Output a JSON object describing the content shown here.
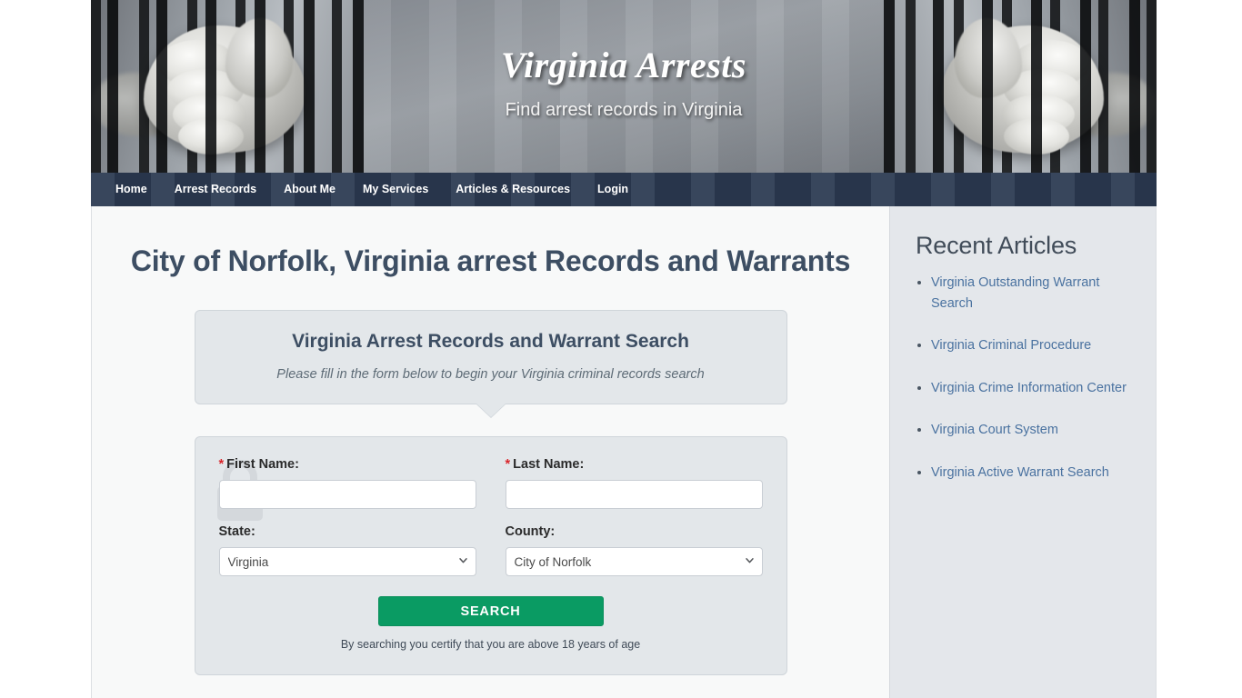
{
  "header": {
    "site_title": "Virginia Arrests",
    "tagline": "Find arrest records in Virginia",
    "banner_image": "hands-gripping-jail-bars-grayscale-photo"
  },
  "nav": {
    "items": [
      {
        "label": "Home"
      },
      {
        "label": "Arrest Records"
      },
      {
        "label": "About Me"
      },
      {
        "label": "My Services"
      },
      {
        "label": "Articles & Resources"
      },
      {
        "label": "Login"
      }
    ]
  },
  "main": {
    "page_heading": "City of Norfolk, Virginia arrest Records and Warrants",
    "callout": {
      "title": "Virginia Arrest Records and Warrant Search",
      "subtitle": "Please fill in the form below to begin your Virginia criminal records search"
    },
    "form": {
      "required_marker": "*",
      "first_name": {
        "label": "First Name:",
        "value": "",
        "placeholder": ""
      },
      "last_name": {
        "label": "Last Name:",
        "value": "",
        "placeholder": ""
      },
      "state": {
        "label": "State:",
        "selected": "Virginia",
        "options": [
          "Virginia"
        ]
      },
      "county": {
        "label": "County:",
        "selected": "City of Norfolk",
        "options": [
          "City of Norfolk"
        ]
      },
      "search_button": "SEARCH",
      "disclaimer": "By searching you certify that you are above 18 years of age"
    }
  },
  "sidebar": {
    "title": "Recent Articles",
    "articles": [
      {
        "label": "Virginia Outstanding Warrant Search"
      },
      {
        "label": "Virginia Criminal Procedure"
      },
      {
        "label": "Virginia Crime Information Center"
      },
      {
        "label": "Virginia Court System"
      },
      {
        "label": "Virginia Active Warrant Search"
      }
    ]
  },
  "colors": {
    "nav_bar": "#2c3b53",
    "heading_text": "#3d4e63",
    "search_button": "#0a9b63",
    "link": "#4a72a0",
    "sidebar_bg": "#e4e7eb",
    "panel_bg": "#e3e7ea",
    "required_star": "#d9252a"
  }
}
